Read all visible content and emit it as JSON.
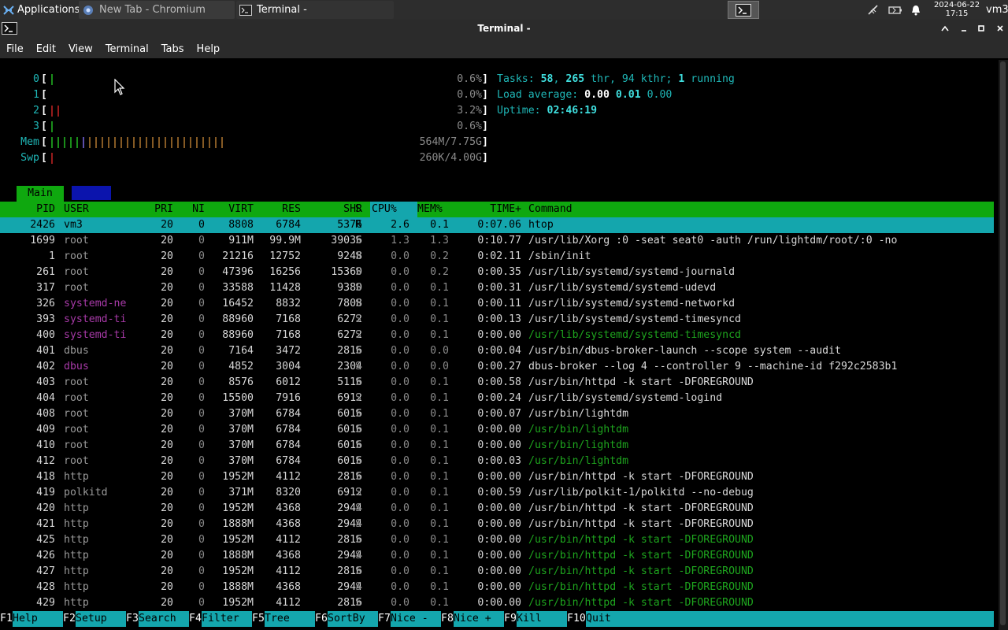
{
  "panel": {
    "apps_label": "Applications",
    "tasks": [
      {
        "label": "New Tab - Chromium"
      },
      {
        "label": "Terminal -"
      }
    ],
    "clock_date": "2024-06-22",
    "clock_time": "17:15",
    "user": "vm3"
  },
  "window": {
    "title": "Terminal -",
    "menu": [
      "File",
      "Edit",
      "View",
      "Terminal",
      "Tabs",
      "Help"
    ]
  },
  "htop": {
    "cpus": [
      {
        "id": "0",
        "pct": "0.6%"
      },
      {
        "id": "1",
        "pct": "0.0%"
      },
      {
        "id": "2",
        "pct": "3.2%"
      },
      {
        "id": "3",
        "pct": "0.6%"
      }
    ],
    "mem": {
      "label": "Mem",
      "value": "564M/7.75G"
    },
    "swp": {
      "label": "Swp",
      "value": "260K/4.00G"
    },
    "tasks_line": {
      "label": "Tasks:",
      "tasks": "58",
      "thr": "265",
      "thr_label": "thr,",
      "kthr": "94",
      "kthr_label": "kthr;",
      "running": "1",
      "running_label": "running"
    },
    "load_line": {
      "label": "Load average:",
      "l1": "0.00",
      "l5": "0.01",
      "l15": "0.00"
    },
    "uptime_line": {
      "label": "Uptime:",
      "value": "02:46:19"
    },
    "tab_main": "Main",
    "columns": [
      "PID",
      "USER",
      "PRI",
      "NI",
      "VIRT",
      "RES",
      "SHR",
      "S",
      "CPU%",
      "MEM%",
      "TIME+",
      "Command"
    ],
    "processes": [
      {
        "pid": "2426",
        "user": "vm3",
        "pri": "20",
        "ni": "0",
        "virt": "8808",
        "res": "6784",
        "shr": "5376",
        "s": "R",
        "cpu": "2.6",
        "mem": "0.1",
        "time": "0:07.06",
        "cmd": "htop"
      },
      {
        "pid": "1699",
        "user": "root",
        "pri": "20",
        "ni": "0",
        "virt": "911M",
        "res": "99.9M",
        "shr": "39036",
        "s": "S",
        "cpu": "1.3",
        "mem": "1.3",
        "time": "0:10.77",
        "cmd": "/usr/lib/Xorg :0 -seat seat0 -auth /run/lightdm/root/:0 -no"
      },
      {
        "pid": "1",
        "user": "root",
        "pri": "20",
        "ni": "0",
        "virt": "21216",
        "res": "12752",
        "shr": "9248",
        "s": "S",
        "cpu": "0.0",
        "mem": "0.2",
        "time": "0:02.11",
        "cmd": "/sbin/init"
      },
      {
        "pid": "261",
        "user": "root",
        "pri": "20",
        "ni": "0",
        "virt": "47396",
        "res": "16256",
        "shr": "15360",
        "s": "S",
        "cpu": "0.0",
        "mem": "0.2",
        "time": "0:00.35",
        "cmd": "/usr/lib/systemd/systemd-journald"
      },
      {
        "pid": "317",
        "user": "root",
        "pri": "20",
        "ni": "0",
        "virt": "33588",
        "res": "11428",
        "shr": "9380",
        "s": "S",
        "cpu": "0.0",
        "mem": "0.1",
        "time": "0:00.31",
        "cmd": "/usr/lib/systemd/systemd-udevd"
      },
      {
        "pid": "326",
        "user": "systemd-ne",
        "pri": "20",
        "ni": "0",
        "virt": "16452",
        "res": "8832",
        "shr": "7808",
        "s": "S",
        "cpu": "0.0",
        "mem": "0.1",
        "time": "0:00.11",
        "cmd": "/usr/lib/systemd/systemd-networkd"
      },
      {
        "pid": "393",
        "user": "systemd-ti",
        "pri": "20",
        "ni": "0",
        "virt": "88960",
        "res": "7168",
        "shr": "6272",
        "s": "S",
        "cpu": "0.0",
        "mem": "0.1",
        "time": "0:00.13",
        "cmd": "/usr/lib/systemd/systemd-timesyncd"
      },
      {
        "pid": "400",
        "user": "systemd-ti",
        "pri": "20",
        "ni": "0",
        "virt": "88960",
        "res": "7168",
        "shr": "6272",
        "s": "S",
        "cpu": "0.0",
        "mem": "0.1",
        "time": "0:00.00",
        "cmd": "/usr/lib/systemd/systemd-timesyncd"
      },
      {
        "pid": "401",
        "user": "dbus",
        "pri": "20",
        "ni": "0",
        "virt": "7164",
        "res": "3472",
        "shr": "2816",
        "s": "S",
        "cpu": "0.0",
        "mem": "0.0",
        "time": "0:00.04",
        "cmd": "/usr/bin/dbus-broker-launch --scope system --audit"
      },
      {
        "pid": "402",
        "user": "dbus",
        "pri": "20",
        "ni": "0",
        "virt": "4852",
        "res": "3004",
        "shr": "2304",
        "s": "S",
        "cpu": "0.0",
        "mem": "0.0",
        "time": "0:00.27",
        "cmd": "dbus-broker --log 4 --controller 9 --machine-id f292c2583b1"
      },
      {
        "pid": "403",
        "user": "root",
        "pri": "20",
        "ni": "0",
        "virt": "8576",
        "res": "6012",
        "shr": "5116",
        "s": "S",
        "cpu": "0.0",
        "mem": "0.1",
        "time": "0:00.58",
        "cmd": "/usr/bin/httpd -k start -DFOREGROUND"
      },
      {
        "pid": "404",
        "user": "root",
        "pri": "20",
        "ni": "0",
        "virt": "15500",
        "res": "7916",
        "shr": "6912",
        "s": "S",
        "cpu": "0.0",
        "mem": "0.1",
        "time": "0:00.24",
        "cmd": "/usr/lib/systemd/systemd-logind"
      },
      {
        "pid": "408",
        "user": "root",
        "pri": "20",
        "ni": "0",
        "virt": "370M",
        "res": "6784",
        "shr": "6016",
        "s": "S",
        "cpu": "0.0",
        "mem": "0.1",
        "time": "0:00.07",
        "cmd": "/usr/bin/lightdm"
      },
      {
        "pid": "409",
        "user": "root",
        "pri": "20",
        "ni": "0",
        "virt": "370M",
        "res": "6784",
        "shr": "6016",
        "s": "S",
        "cpu": "0.0",
        "mem": "0.1",
        "time": "0:00.00",
        "cmd": "/usr/bin/lightdm"
      },
      {
        "pid": "410",
        "user": "root",
        "pri": "20",
        "ni": "0",
        "virt": "370M",
        "res": "6784",
        "shr": "6016",
        "s": "S",
        "cpu": "0.0",
        "mem": "0.1",
        "time": "0:00.00",
        "cmd": "/usr/bin/lightdm"
      },
      {
        "pid": "412",
        "user": "root",
        "pri": "20",
        "ni": "0",
        "virt": "370M",
        "res": "6784",
        "shr": "6016",
        "s": "S",
        "cpu": "0.0",
        "mem": "0.1",
        "time": "0:00.03",
        "cmd": "/usr/bin/lightdm"
      },
      {
        "pid": "418",
        "user": "http",
        "pri": "20",
        "ni": "0",
        "virt": "1952M",
        "res": "4112",
        "shr": "2816",
        "s": "S",
        "cpu": "0.0",
        "mem": "0.1",
        "time": "0:00.00",
        "cmd": "/usr/bin/httpd -k start -DFOREGROUND"
      },
      {
        "pid": "419",
        "user": "polkitd",
        "pri": "20",
        "ni": "0",
        "virt": "371M",
        "res": "8320",
        "shr": "6912",
        "s": "S",
        "cpu": "0.0",
        "mem": "0.1",
        "time": "0:00.59",
        "cmd": "/usr/lib/polkit-1/polkitd --no-debug"
      },
      {
        "pid": "420",
        "user": "http",
        "pri": "20",
        "ni": "0",
        "virt": "1952M",
        "res": "4368",
        "shr": "2944",
        "s": "S",
        "cpu": "0.0",
        "mem": "0.1",
        "time": "0:00.00",
        "cmd": "/usr/bin/httpd -k start -DFOREGROUND"
      },
      {
        "pid": "421",
        "user": "http",
        "pri": "20",
        "ni": "0",
        "virt": "1888M",
        "res": "4368",
        "shr": "2944",
        "s": "S",
        "cpu": "0.0",
        "mem": "0.1",
        "time": "0:00.00",
        "cmd": "/usr/bin/httpd -k start -DFOREGROUND"
      },
      {
        "pid": "425",
        "user": "http",
        "pri": "20",
        "ni": "0",
        "virt": "1952M",
        "res": "4112",
        "shr": "2816",
        "s": "S",
        "cpu": "0.0",
        "mem": "0.1",
        "time": "0:00.00",
        "cmd": "/usr/bin/httpd -k start -DFOREGROUND"
      },
      {
        "pid": "426",
        "user": "http",
        "pri": "20",
        "ni": "0",
        "virt": "1888M",
        "res": "4368",
        "shr": "2944",
        "s": "S",
        "cpu": "0.0",
        "mem": "0.1",
        "time": "0:00.00",
        "cmd": "/usr/bin/httpd -k start -DFOREGROUND"
      },
      {
        "pid": "427",
        "user": "http",
        "pri": "20",
        "ni": "0",
        "virt": "1952M",
        "res": "4112",
        "shr": "2816",
        "s": "S",
        "cpu": "0.0",
        "mem": "0.1",
        "time": "0:00.00",
        "cmd": "/usr/bin/httpd -k start -DFOREGROUND"
      },
      {
        "pid": "428",
        "user": "http",
        "pri": "20",
        "ni": "0",
        "virt": "1888M",
        "res": "4368",
        "shr": "2944",
        "s": "S",
        "cpu": "0.0",
        "mem": "0.1",
        "time": "0:00.00",
        "cmd": "/usr/bin/httpd -k start -DFOREGROUND"
      },
      {
        "pid": "429",
        "user": "http",
        "pri": "20",
        "ni": "0",
        "virt": "1952M",
        "res": "4112",
        "shr": "2816",
        "s": "S",
        "cpu": "0.0",
        "mem": "0.1",
        "time": "0:00.00",
        "cmd": "/usr/bin/httpd -k start -DFOREGROUND"
      }
    ],
    "fkeys": [
      {
        "key": "F1",
        "label": "Help"
      },
      {
        "key": "F2",
        "label": "Setup"
      },
      {
        "key": "F3",
        "label": "Search"
      },
      {
        "key": "F4",
        "label": "Filter"
      },
      {
        "key": "F5",
        "label": "Tree"
      },
      {
        "key": "F6",
        "label": "SortBy"
      },
      {
        "key": "F7",
        "label": "Nice -"
      },
      {
        "key": "F8",
        "label": "Nice +"
      },
      {
        "key": "F9",
        "label": "Kill"
      },
      {
        "key": "F10",
        "label": "Quit"
      }
    ]
  },
  "colors": {
    "header_green": "#0fa80f",
    "selection_cyan": "#14a6ad",
    "user_magenta": "#9c2f9c",
    "thread_green": "#1ea51e"
  }
}
